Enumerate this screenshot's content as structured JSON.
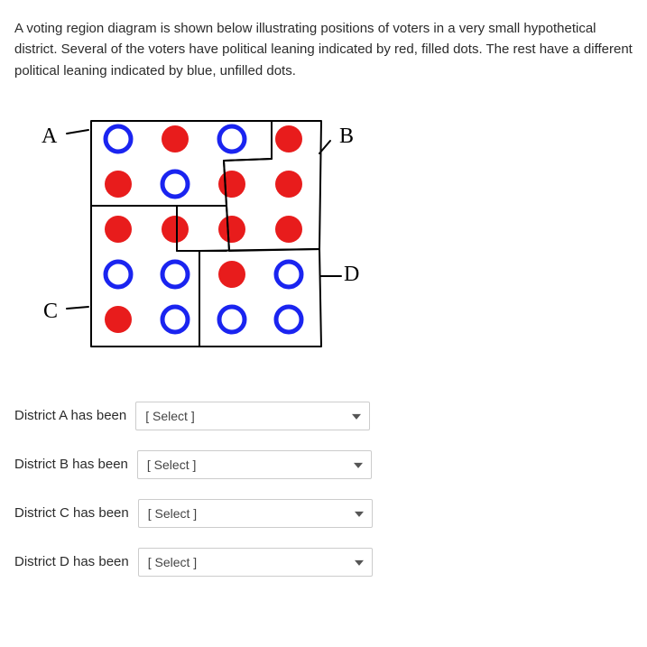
{
  "prompt": "A voting region diagram is shown below illustrating positions of voters in a very small hypothetical district.  Several of the voters have political leaning indicated by red, filled dots.  The rest have a different political leaning indicated by blue, unfilled dots.",
  "diagram": {
    "labels": {
      "A": "A",
      "B": "B",
      "C": "C",
      "D": "D"
    },
    "grid": [
      [
        {
          "t": "blue"
        },
        {
          "t": "red"
        },
        {
          "t": "blue"
        },
        {
          "t": "red"
        }
      ],
      [
        {
          "t": "red"
        },
        {
          "t": "blue"
        },
        {
          "t": "red"
        },
        {
          "t": "red"
        }
      ],
      [
        {
          "t": "red"
        },
        {
          "t": "red"
        },
        {
          "t": "red"
        },
        {
          "t": "red"
        }
      ],
      [
        {
          "t": "blue"
        },
        {
          "t": "blue"
        },
        {
          "t": "red"
        },
        {
          "t": "blue"
        }
      ],
      [
        {
          "t": "red"
        },
        {
          "t": "blue"
        },
        {
          "t": "blue"
        },
        {
          "t": "blue"
        }
      ]
    ]
  },
  "questions": [
    {
      "label": "District A has been",
      "placeholder": "[ Select ]"
    },
    {
      "label": "District B has been",
      "placeholder": "[ Select ]"
    },
    {
      "label": "District C has been",
      "placeholder": "[ Select ]"
    },
    {
      "label": "District D has been",
      "placeholder": "[ Select ]"
    }
  ]
}
